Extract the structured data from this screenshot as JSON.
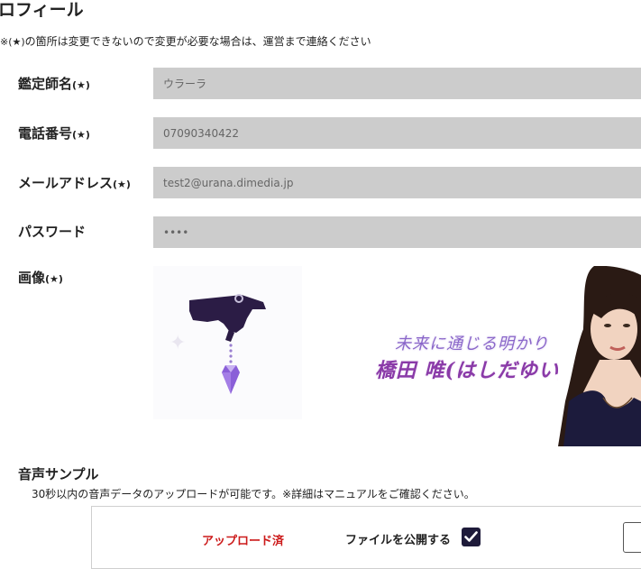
{
  "page": {
    "title": "ロフィール",
    "notice_prefix": "※(★)",
    "notice_text": "の箇所は変更できないので変更が必要な場合は、運営まで連絡ください"
  },
  "fields": [
    {
      "label": "鑑定師名",
      "star": "(★)",
      "value": "ウラーラ"
    },
    {
      "label": "電話番号",
      "star": "(★)",
      "value": "07090340422"
    },
    {
      "label": "メールアドレス",
      "star": "(★)",
      "value": "test2@urana.dimedia.jp"
    },
    {
      "label": "パスワード",
      "star": "",
      "value": "••••"
    }
  ],
  "image_section": {
    "label": "画像",
    "star": "(★)",
    "banner_line1": "未来に通じる明かり",
    "banner_line2": "橋田 唯(はしだゆい)"
  },
  "voice_sample": {
    "title": "音声サンプル",
    "description": "30秒以内の音声データのアップロードが可能です。※詳細はマニュアルをご確認ください。",
    "upload_status": "アップロード済",
    "publish_label": "ファイルを公開する",
    "publish_checked": true
  },
  "icons": {
    "check": "checkmark-icon",
    "logo": "hand-crystal-pendulum-icon"
  },
  "colors": {
    "input_bg": "#cccccc",
    "status_red": "#cc1a1a",
    "checkbox_bg": "#1e1b3a",
    "banner_purple": "#7a4fb0"
  }
}
